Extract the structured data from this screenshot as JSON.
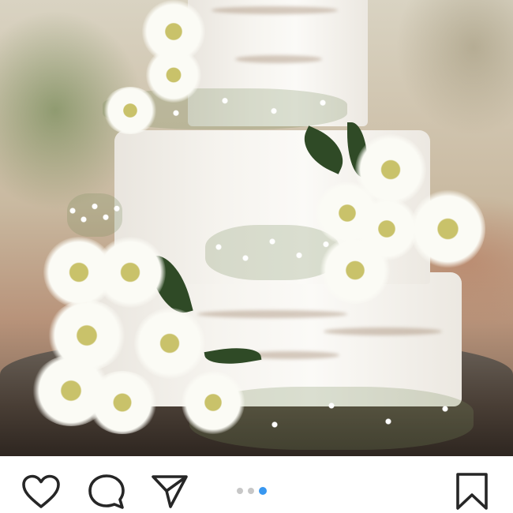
{
  "post": {
    "image_alt": "",
    "carousel": {
      "count": 3,
      "active_index": 3
    }
  },
  "actions": {
    "like_icon": "heart-outline-icon",
    "comment_icon": "comment-bubble-icon",
    "share_icon": "paper-plane-icon",
    "save_icon": "bookmark-outline-icon"
  },
  "colors": {
    "active_dot": "#3897f0",
    "inactive_dot": "#c7c7c7",
    "icon_stroke": "#262626"
  }
}
